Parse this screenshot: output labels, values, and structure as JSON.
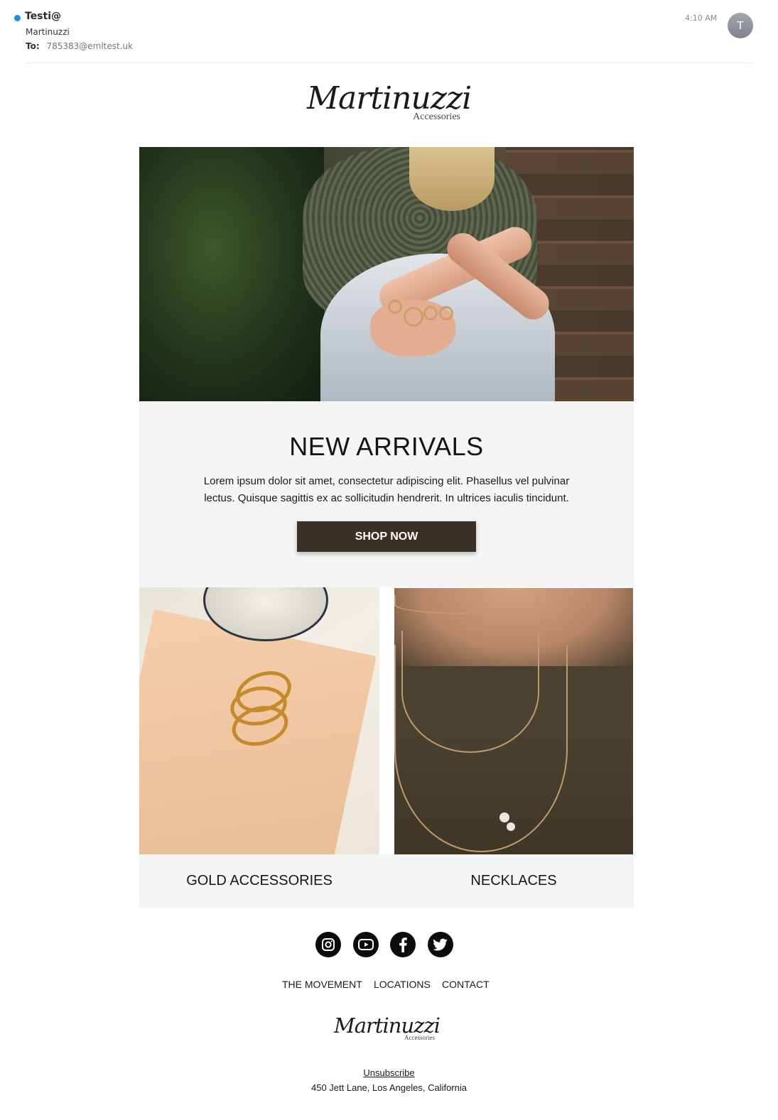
{
  "email": {
    "sender": "Testi@",
    "subject": "Martinuzzi",
    "to_label": "To:",
    "to_address": "785383@emltest.uk",
    "time": "4:10 AM",
    "avatar_initial": "T"
  },
  "brand": {
    "logo_text": "Martinuzzi",
    "logo_subtext": "Accessories"
  },
  "hero": {
    "title": "NEW ARRIVALS",
    "body": "Lorem ipsum dolor sit amet, consectetur adipiscing elit. Phasellus vel pulvinar lectus. Quisque sagittis ex ac sollicitudin hendrerit. In ultrices iaculis tincidunt.",
    "cta_label": "SHOP NOW"
  },
  "products": [
    {
      "label": "GOLD ACCESSORIES"
    },
    {
      "label": "NECKLACES"
    }
  ],
  "social": [
    {
      "icon": "instagram-icon"
    },
    {
      "icon": "youtube-icon"
    },
    {
      "icon": "facebook-icon"
    },
    {
      "icon": "twitter-icon"
    }
  ],
  "footer": {
    "nav": [
      "THE MOVEMENT",
      "LOCATIONS",
      "CONTACT"
    ],
    "unsubscribe": "Unsubscribe",
    "address": "450 Jett Lane, Los Angeles, California"
  },
  "colors": {
    "unread_dot": "#1a8fe3",
    "button_bg": "#3a3126",
    "panel_bg": "#f5f5f5"
  }
}
